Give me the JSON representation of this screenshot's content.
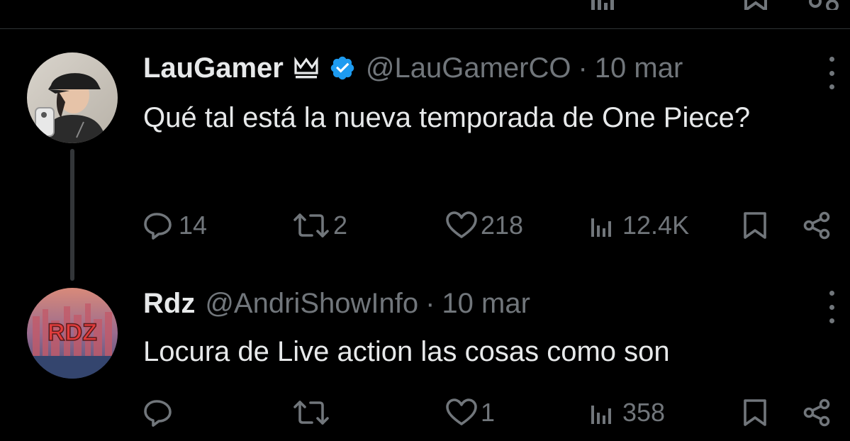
{
  "tweets": [
    {
      "author_name": "LauGamer",
      "author_handle": "@LauGamerCO",
      "date": "10 mar",
      "separator": "·",
      "text": "Qué tal está la nueva temporada de One Piece?",
      "verified": true,
      "badge_icon": "crown-icon",
      "replies": "14",
      "reposts": "2",
      "likes": "218",
      "views": "12.4K"
    },
    {
      "author_name": "Rdz",
      "author_handle": "@AndriShowInfo",
      "date": "10 mar",
      "separator": "·",
      "text": "Locura de Live action las cosas como son",
      "avatar_text": "RDZ",
      "replies": "",
      "reposts": "",
      "likes": "1",
      "views": "358"
    }
  ],
  "colors": {
    "background": "#000000",
    "text_primary": "#e7e9ea",
    "text_secondary": "#71767b",
    "verified": "#1d9bf0",
    "divider": "#2f3336"
  },
  "icons": [
    "reply-icon",
    "repost-icon",
    "like-icon",
    "views-icon",
    "bookmark-icon",
    "share-icon",
    "more-icon",
    "verified-icon",
    "crown-icon"
  ]
}
